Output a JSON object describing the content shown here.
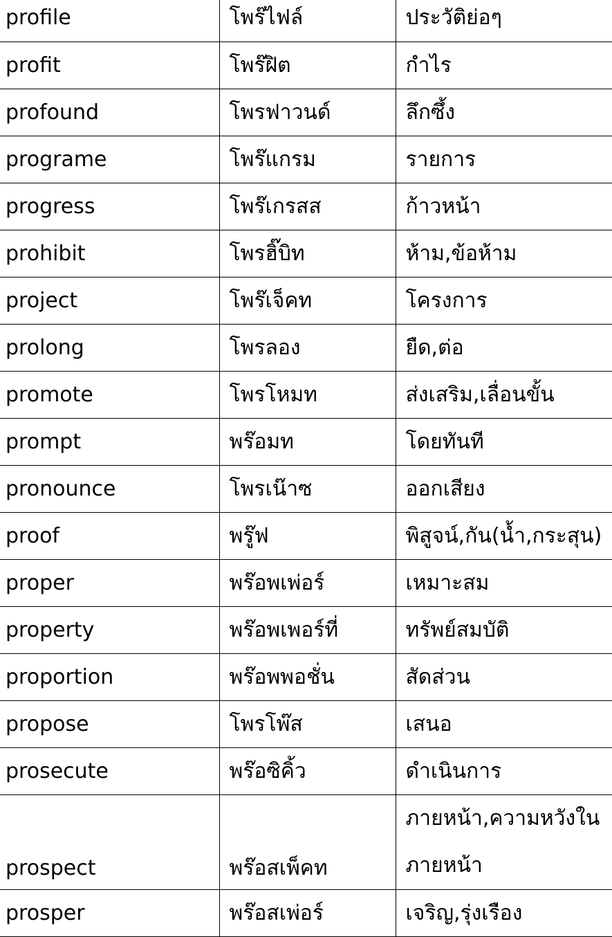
{
  "rows": [
    {
      "word": "profile",
      "pronunciation": "โพร๊ไฟล์",
      "meaning": "ประวัติย่อๆ"
    },
    {
      "word": "profit",
      "pronunciation": "โพร๊ฝิต",
      "meaning": "กำไร"
    },
    {
      "word": "profound",
      "pronunciation": "โพรฟาวนด์",
      "meaning": "ลึกซึ้ง"
    },
    {
      "word": "programe",
      "pronunciation": "โพร๊แกรม",
      "meaning": "รายการ"
    },
    {
      "word": "progress",
      "pronunciation": "โพร๊เกรสส",
      "meaning": "ก้าวหน้า"
    },
    {
      "word": "prohibit",
      "pronunciation": "โพรฮิ๊บิท",
      "meaning": "ห้าม,ข้อห้าม"
    },
    {
      "word": "project",
      "pronunciation": "โพร๊เจ็คท",
      "meaning": "โครงการ"
    },
    {
      "word": "prolong",
      "pronunciation": "โพรลอง",
      "meaning": "ยืด,ต่อ"
    },
    {
      "word": "promote",
      "pronunciation": "โพรโหมท",
      "meaning": "ส่งเสริม,เลื่อนขั้น"
    },
    {
      "word": "prompt",
      "pronunciation": "พร๊อมท",
      "meaning": "โดยทันที"
    },
    {
      "word": "pronounce",
      "pronunciation": "โพรเน๊าซ",
      "meaning": "ออกเสียง"
    },
    {
      "word": "proof",
      "pronunciation": "พรู๊ฟ",
      "meaning": "พิสูจน์,กัน(น้ำ,กระสุน)"
    },
    {
      "word": "proper",
      "pronunciation": "พร๊อพเพ่อร์",
      "meaning": "เหมาะสม"
    },
    {
      "word": "property",
      "pronunciation": "พร๊อพเพอร์ที่",
      "meaning": "ทรัพย์สมบัติ"
    },
    {
      "word": "proportion",
      "pronunciation": "พร๊อพพอชั่น",
      "meaning": "สัดส่วน"
    },
    {
      "word": "propose",
      "pronunciation": "โพรโพ๊ส",
      "meaning": "เสนอ"
    },
    {
      "word": "prosecute",
      "pronunciation": "พร๊อซิคิ้ว",
      "meaning": "ดำเนินการ"
    },
    {
      "word": "prospect",
      "pronunciation": "พร๊อสเพ็คท",
      "meaning": "ภายหน้า,ความหวังในภายหน้า"
    },
    {
      "word": "prosper",
      "pronunciation": "พร๊อสเพ่อร์",
      "meaning": "เจริญ,รุ่งเรือง"
    }
  ]
}
